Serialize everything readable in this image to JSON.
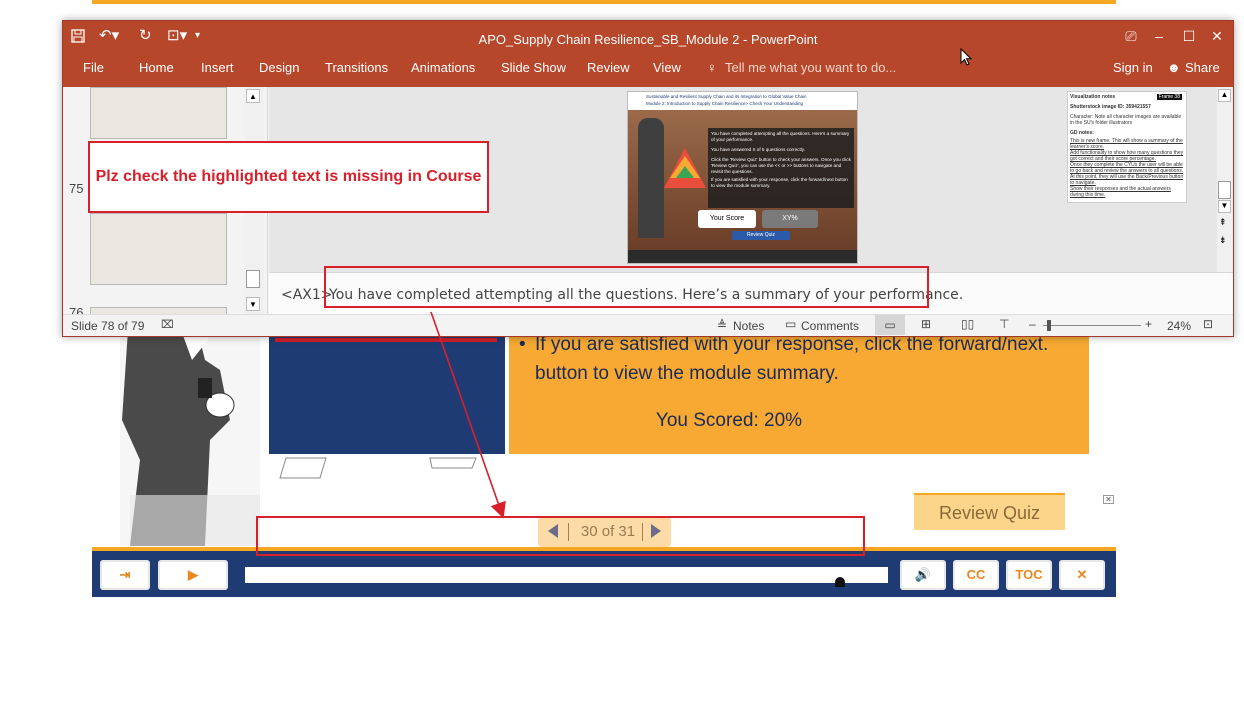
{
  "window": {
    "title": "APO_Supply Chain Resilience_SB_Module 2 - PowerPoint",
    "controls": {
      "restore_ribbon": "⎚",
      "minimize": "–",
      "maximize": "☐",
      "close": "✕"
    }
  },
  "ribbon": {
    "tabs": [
      "File",
      "Home",
      "Insert",
      "Design",
      "Transitions",
      "Animations",
      "Slide Show",
      "Review",
      "View"
    ],
    "tell_me": "Tell me what you want to do...",
    "sign_in": "Sign in",
    "share": "Share"
  },
  "thumbnails": {
    "numbers": [
      "75",
      "76"
    ]
  },
  "slide": {
    "header_line1": "Sustainable and Resilient Supply Chain and its Integration to Global Value Chain",
    "header_line2": "Module 2: Introduction to Supply Chain Resilience> Check Your Understanding",
    "body_p1": "You have completed attempting all the questions. Here's a summary of your performance.",
    "body_p2": "You have answered X of 5 questions correctly.",
    "bullet1": "Click the 'Review Quiz' button to check your answers. Once you click 'Review Quiz', you can use the << or >> buttons to navigate and revisit the questions.",
    "bullet2": "If you are satisfied with your response, click the forward/next button to view the module summary.",
    "your_score": "Your Score",
    "score_value": "XY%",
    "review_quiz": "Review Quiz"
  },
  "side_notes": {
    "title": "Visualization notes",
    "frame": "Frame 38",
    "line1": "Shutterstock image ID: 359421557",
    "line2": "Character: Note all character images are available in the SU's folder illustrators",
    "line3": "GD notes:",
    "line4": "This is new frame. This will show a summary of the learner's score.",
    "line5": "Add functionality to show how many questions they got correct and their score percentage.",
    "line6": "Once they complete the CYUs the user will be able to go back and review the answers to all questions.",
    "line7": "At this point, they will use the Back/Previous button to navigate.",
    "line8": "Show their responses and the actual answers during this time."
  },
  "notes_pane": {
    "tag": "<AX1>",
    "text": "You have completed attempting all the questions. Here’s a summary of your performance."
  },
  "statusbar": {
    "slide_info": "Slide 78 of 79",
    "notes": "Notes",
    "comments": "Comments",
    "zoom": "24%"
  },
  "annotation": {
    "callout": "Plz check the highlighted text is missing in Course"
  },
  "course": {
    "bullet_text": "If you are satisfied with your response, click the forward/next. button to view the module summary.",
    "score": "You Scored: 20%",
    "review_quiz": "Review Quiz",
    "pager": "30 of 31",
    "controls": {
      "exit": "⇥",
      "play": "▶",
      "volume": "🔊",
      "cc": "CC",
      "toc": "TOC",
      "close": "✕"
    },
    "colors": {
      "navy": "#1f3b73",
      "orange": "#f7a933",
      "accent": "#e8871e"
    }
  }
}
